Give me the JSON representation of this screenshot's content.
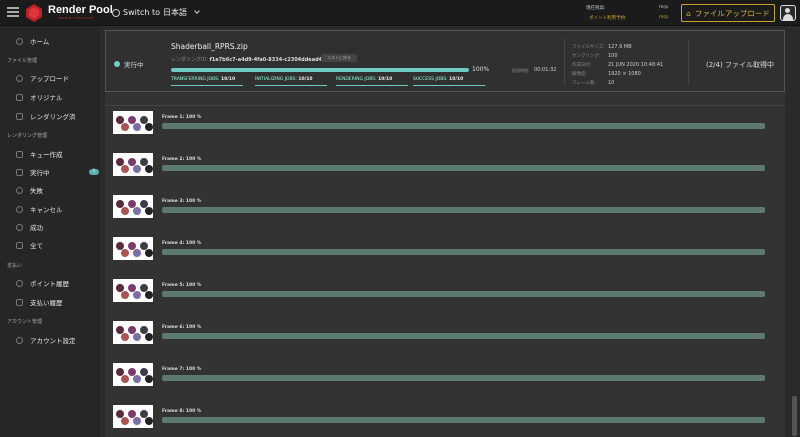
{
  "header": {
    "brand": "Render Pool",
    "brand_sub": "MADE BY ITOLE DUP",
    "lang_prefix": "Switch to",
    "lang_value": "日本語",
    "points_label": "現在残高:",
    "points_value": "mrp",
    "points_pending_label": "ポイント利用予約:",
    "points_pending_value": "mrp",
    "upload_button": "ファイルアップロード"
  },
  "sidebar": {
    "home": "ホーム",
    "sections": {
      "files": "ファイル管理",
      "rendering": "レンダリング管理",
      "payment": "支払い",
      "account": "アカウント管理"
    },
    "files_items": [
      {
        "label": "アップロード",
        "icon": "cloud-icon"
      },
      {
        "label": "オリジナル",
        "icon": "file-icon"
      },
      {
        "label": "レンダリング済",
        "icon": "bolt-icon"
      }
    ],
    "rendering_items": [
      {
        "label": "キュー作成",
        "icon": "shield-icon"
      },
      {
        "label": "実行中",
        "icon": "play-icon",
        "badge": "1"
      },
      {
        "label": "失敗",
        "icon": "hand-icon"
      },
      {
        "label": "キャンセル",
        "icon": "cancel-icon"
      },
      {
        "label": "成功",
        "icon": "check-icon"
      },
      {
        "label": "全て",
        "icon": "stack-icon"
      }
    ],
    "payment_items": [
      {
        "label": "ポイント履歴",
        "icon": "coin-icon"
      },
      {
        "label": "支払い履歴",
        "icon": "receipt-icon"
      }
    ],
    "account_items": [
      {
        "label": "アカウント設定",
        "icon": "user-icon"
      }
    ]
  },
  "job": {
    "status": "実行中",
    "filename": "Shaderball_RPRS.zip",
    "id_label": "レンダリングID:",
    "id": "f1e7b6c7-a4d9-4fa0-8334-c2304ddead4a",
    "copy_label": "リストに戻る",
    "progress": 100,
    "progress_text": "100%",
    "elapsed_label": "経過時間:",
    "elapsed": "00:01:32",
    "stages": [
      {
        "label": "TRANSFERRING JOBS:",
        "value": "10/10"
      },
      {
        "label": "INITIALIZING JOBS:",
        "value": "10/10"
      },
      {
        "label": "RENDERING JOBS:",
        "value": "10/10"
      },
      {
        "label": "SUCCESS JOBS:",
        "value": "10/10"
      }
    ],
    "info": [
      {
        "label": "ファイルサイズ:",
        "value": "127.9 MB"
      },
      {
        "label": "サンプリング:",
        "value": "100"
      },
      {
        "label": "作成日付:",
        "value": "21 JUN 2020 10:48:41"
      },
      {
        "label": "解像度:",
        "value": "1920 × 1080"
      },
      {
        "label": "フレーム数:",
        "value": "10"
      }
    ],
    "fraction": "(2/4) ファイル取得中"
  },
  "frames": [
    {
      "label": "Frame 1: 100 %",
      "progress": 100
    },
    {
      "label": "Frame 2: 100 %",
      "progress": 100
    },
    {
      "label": "Frame 3: 100 %",
      "progress": 100
    },
    {
      "label": "Frame 4: 100 %",
      "progress": 100
    },
    {
      "label": "Frame 5: 100 %",
      "progress": 100
    },
    {
      "label": "Frame 6: 100 %",
      "progress": 100
    },
    {
      "label": "Frame 7: 100 %",
      "progress": 100
    },
    {
      "label": "Frame 8: 100 %",
      "progress": 100
    }
  ],
  "colors": {
    "accent": "#6ecdc3",
    "gold": "#d8b13a",
    "bar": "#5c7a72"
  }
}
